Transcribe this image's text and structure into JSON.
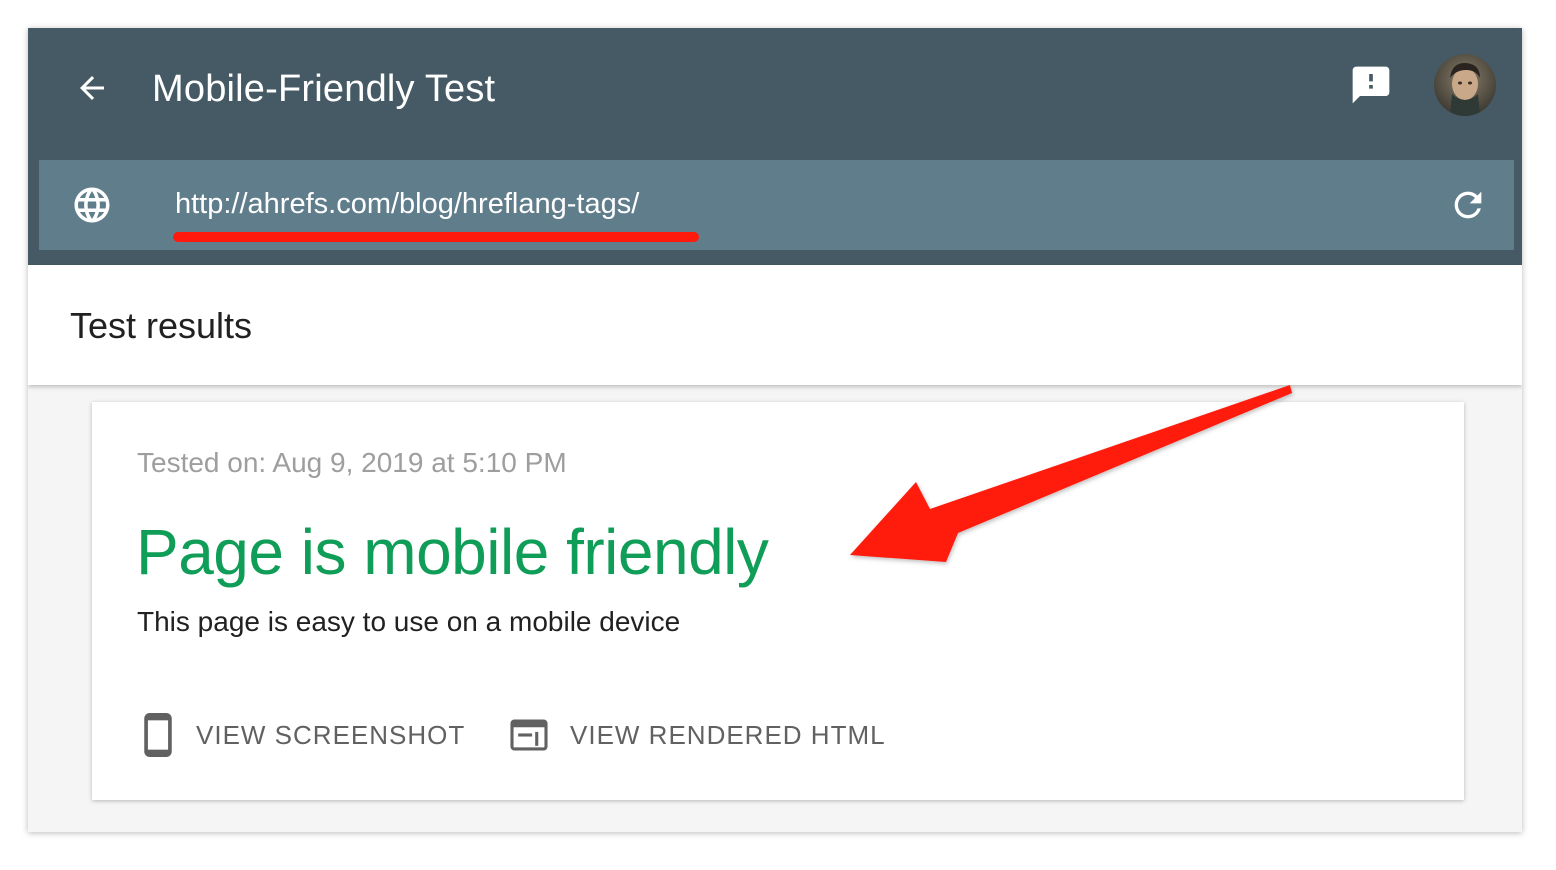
{
  "app": {
    "title": "Mobile-Friendly Test"
  },
  "url_bar": {
    "value": "http://ahrefs.com/blog/hreflang-tags/"
  },
  "results": {
    "heading": "Test results",
    "tested_on": "Tested on: Aug 9, 2019 at 5:10 PM",
    "verdict": "Page is mobile friendly",
    "description": "This page is easy to use on a mobile device",
    "actions": [
      {
        "label": "VIEW SCREENSHOT",
        "icon": "phone-icon"
      },
      {
        "label": "VIEW RENDERED HTML",
        "icon": "browser-window-icon"
      }
    ]
  },
  "icons": {
    "back": "arrow-back-icon",
    "feedback": "feedback-icon",
    "globe": "globe-icon",
    "refresh": "refresh-icon"
  },
  "colors": {
    "appbar": "#455a64",
    "url_bar": "#607d8b",
    "verdict_green": "#0f9d58",
    "annotation_red": "#ff1a0d"
  }
}
